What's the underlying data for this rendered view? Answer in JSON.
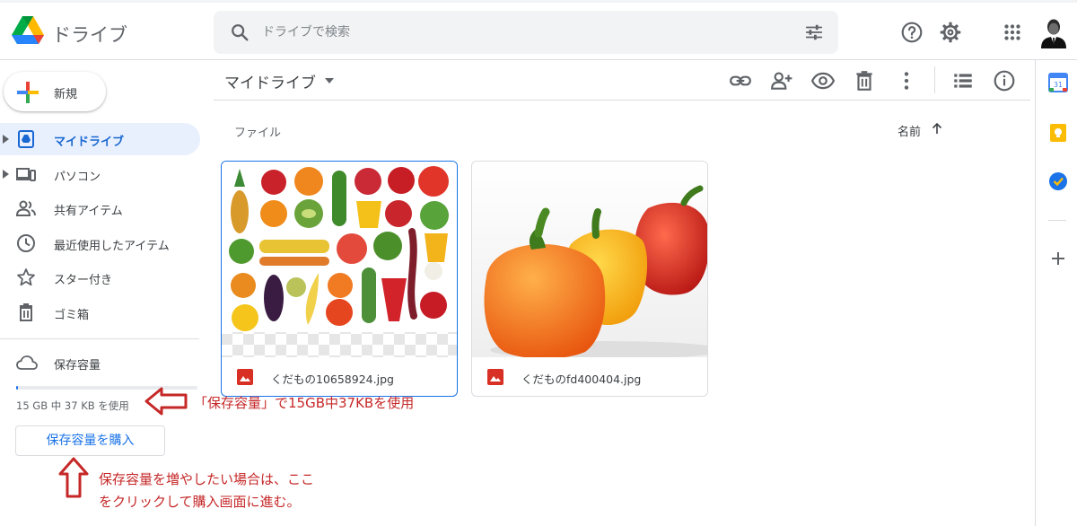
{
  "app": {
    "title": "ドライブ"
  },
  "search": {
    "placeholder": "ドライブで検索",
    "value": ""
  },
  "header": {
    "icons": [
      "help-icon",
      "settings-icon",
      "apps-icon",
      "avatar"
    ]
  },
  "sidebar": {
    "new_label": "新規",
    "items": [
      {
        "label": "マイドライブ",
        "icon": "my-drive-icon",
        "active": true,
        "expandable": true
      },
      {
        "label": "パソコン",
        "icon": "computers-icon",
        "active": false,
        "expandable": true
      },
      {
        "label": "共有アイテム",
        "icon": "shared-icon",
        "active": false,
        "expandable": false
      },
      {
        "label": "最近使用したアイテム",
        "icon": "recent-icon",
        "active": false,
        "expandable": false
      },
      {
        "label": "スター付き",
        "icon": "star-icon",
        "active": false,
        "expandable": false
      },
      {
        "label": "ゴミ箱",
        "icon": "trash-icon",
        "active": false,
        "expandable": false
      }
    ],
    "storage": {
      "label": "保存容量",
      "usage_text": "15 GB 中 37 KB を使用",
      "used_fraction": 0.01,
      "buy_label": "保存容量を購入"
    }
  },
  "main": {
    "title": "マイドライブ",
    "toolbar": [
      "link-icon",
      "add-person-icon",
      "preview-icon",
      "trash-icon",
      "more-icon",
      "list-view-icon",
      "info-icon"
    ],
    "section_label": "ファイル",
    "sort_label": "名前",
    "files": [
      {
        "name": "くだもの10658924.jpg",
        "type": "image",
        "selected": true
      },
      {
        "name": "くだものfd400404.jpg",
        "type": "image",
        "selected": false
      }
    ]
  },
  "rail": {
    "icons": [
      "calendar-icon",
      "keep-icon",
      "tasks-icon",
      "add-addon-icon"
    ],
    "calendar_day": "31"
  },
  "annotations": {
    "storage_note": "「保存容量」で15GB中37KBを使用",
    "buy_note_line1": "保存容量を増やしたい場合は、ここ",
    "buy_note_line2": "をクリックして購入画面に進む。"
  },
  "colors": {
    "accent": "#1a73e8",
    "active_bg": "#e8f0fe",
    "annotation": "#c62828"
  }
}
